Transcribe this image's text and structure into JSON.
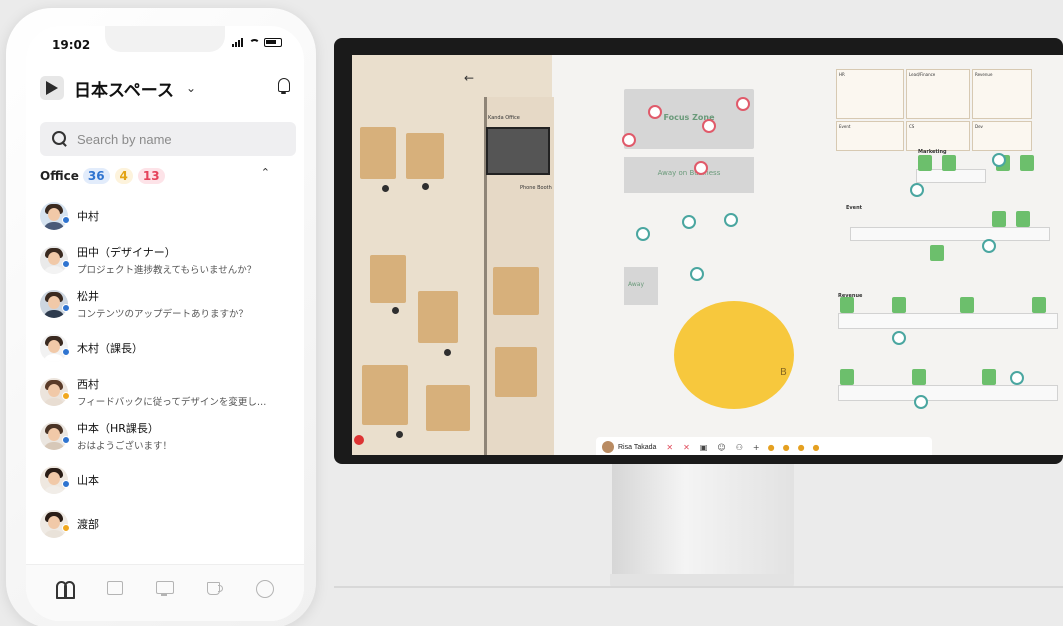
{
  "phone": {
    "time": "19:02",
    "space_name": "日本スペース",
    "search_placeholder": "Search by name",
    "office": {
      "label": "Office",
      "count_blue": "36",
      "count_orange": "4",
      "count_red": "13"
    },
    "members": [
      {
        "name": "中村",
        "status": "",
        "status_color": "#2f74d0"
      },
      {
        "name": "田中（デザイナー）",
        "status": "プロジェクト進捗教えてもらいませんか？",
        "status_color": "#2f74d0"
      },
      {
        "name": "松井",
        "status": "コンテンツのアップデートありますか？",
        "status_color": "#2f74d0"
      },
      {
        "name": "木村（課長）",
        "status": "",
        "status_color": "#2f74d0"
      },
      {
        "name": "西村",
        "status": "フィードバックに従ってデザインを変更し…",
        "status_color": "#f0a820"
      },
      {
        "name": "中本（HR課長）",
        "status": "おはようございます！",
        "status_color": "#2f74d0"
      },
      {
        "name": "山本",
        "status": "",
        "status_color": "#2f74d0"
      },
      {
        "name": "渡部",
        "status": "",
        "status_color": "#f0a820"
      }
    ],
    "tabs": [
      "people-icon",
      "chat-icon",
      "screen-icon",
      "cup-icon",
      "profile-icon"
    ]
  },
  "monitor": {
    "areas": {
      "office_name": "Kanda Office",
      "phone_booth": "Phone Booth",
      "focus_zone": "Focus Zone",
      "away_business": "Away on Business",
      "away": "Away",
      "lounge_letter": "B"
    },
    "departments": [
      "Marketing",
      "Event",
      "Revenue"
    ],
    "panels": [
      "HR",
      "Lead/Finance",
      "Revenue",
      "Event",
      "CS",
      "Dev"
    ],
    "bottom_bar": {
      "self_name": "Risa Takada"
    }
  },
  "colors": {
    "accent_blue": "#2f74d0",
    "accent_orange": "#e3a313",
    "accent_red": "#e5435b",
    "lounge_yellow": "#f7c83d"
  }
}
